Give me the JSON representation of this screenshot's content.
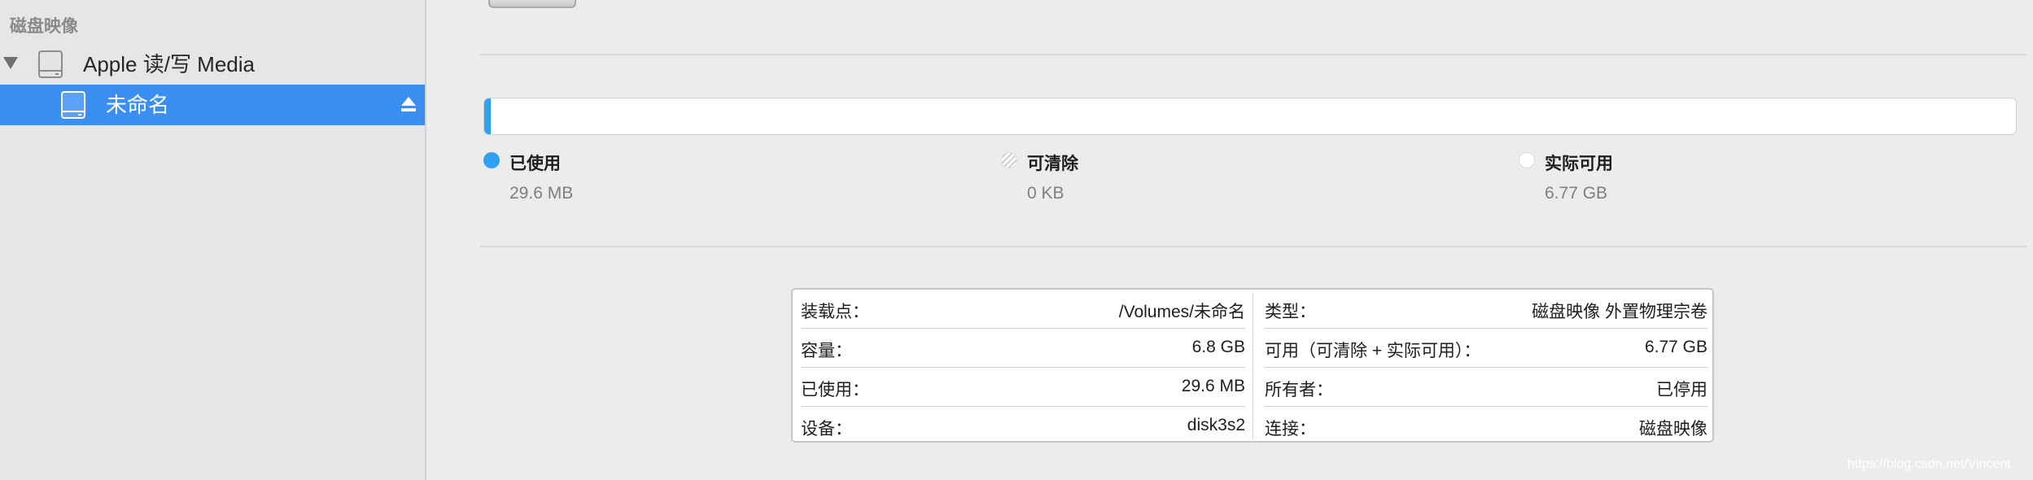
{
  "sidebar": {
    "section_title": "磁盘映像",
    "device": {
      "label": "Apple 读/写 Media",
      "icon": "drive-icon",
      "expanded": true
    },
    "volume": {
      "label": "未命名",
      "icon": "drive-icon",
      "selected": true,
      "eject_icon": "eject-icon"
    }
  },
  "usage": {
    "used_fraction": 0.0044,
    "colors": {
      "used": "#2ea1f3",
      "selection": "#3b8ff3"
    },
    "legend": [
      {
        "name": "已使用",
        "value": "29.6 MB"
      },
      {
        "name": "可清除",
        "value": "0 KB"
      },
      {
        "name": "实际可用",
        "value": "6.77 GB"
      }
    ]
  },
  "info": {
    "left": [
      {
        "key": "装载点：",
        "value": "/Volumes/未命名"
      },
      {
        "key": "容量：",
        "value": "6.8 GB"
      },
      {
        "key": "已使用：",
        "value": "29.6 MB"
      },
      {
        "key": "设备：",
        "value": "disk3s2"
      }
    ],
    "right": [
      {
        "key": "类型：",
        "value": "磁盘映像 外置物理宗卷"
      },
      {
        "key": "可用（可清除 + 实际可用）：",
        "value": "6.77 GB"
      },
      {
        "key": "所有者：",
        "value": "已停用"
      },
      {
        "key": "连接：",
        "value": "磁盘映像"
      }
    ]
  },
  "watermark": "https://blog.csdn.net/Vincent"
}
